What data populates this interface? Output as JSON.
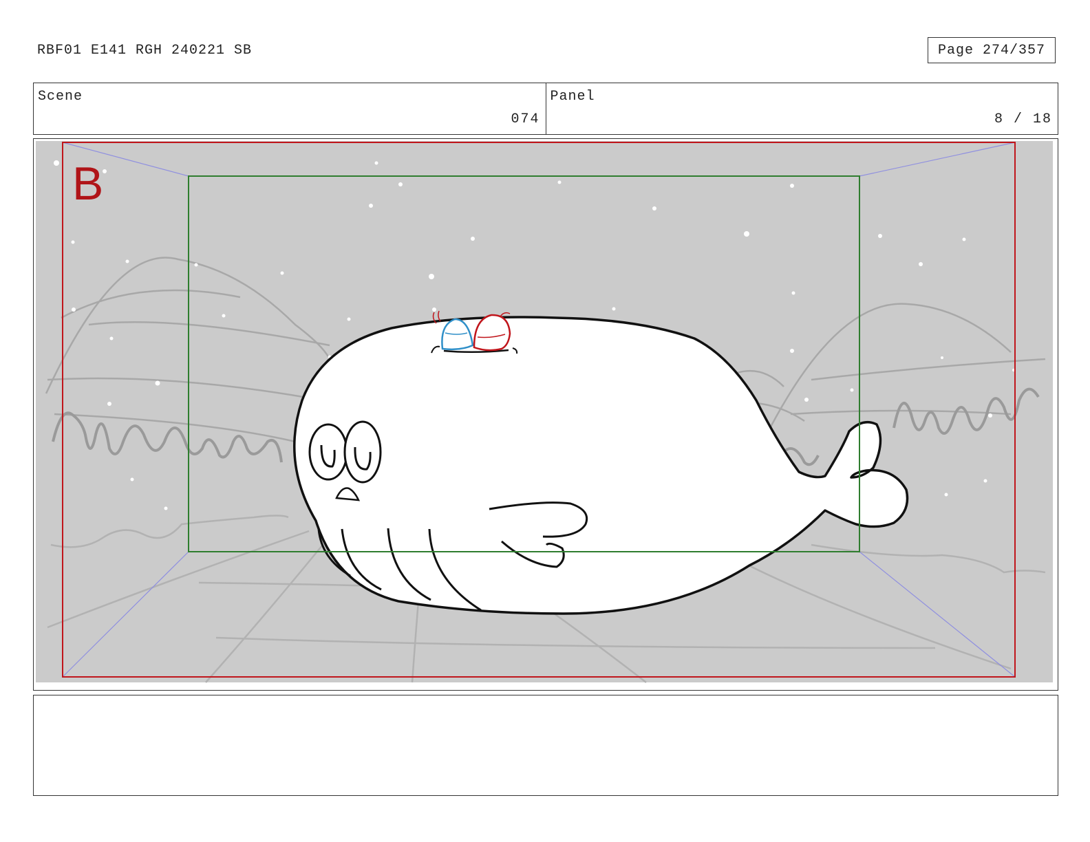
{
  "header": {
    "doc_title": "RBF01 E141 RGH 240221 SB",
    "page_label": "Page 274/357"
  },
  "info": {
    "scene_label": "Scene",
    "scene_value": "074",
    "panel_label": "Panel",
    "panel_value": "8 / 18"
  },
  "panel": {
    "frame_mark": "B",
    "colors": {
      "background": "#cbcbcb",
      "safe_frame": "#c0151b",
      "action_frame": "#2e7d2e",
      "perspective_lines": "#8f8fe0",
      "outline": "#111111",
      "left_character": "#2f8fc8",
      "right_character": "#c0151b"
    }
  },
  "notes": {
    "text": ""
  }
}
